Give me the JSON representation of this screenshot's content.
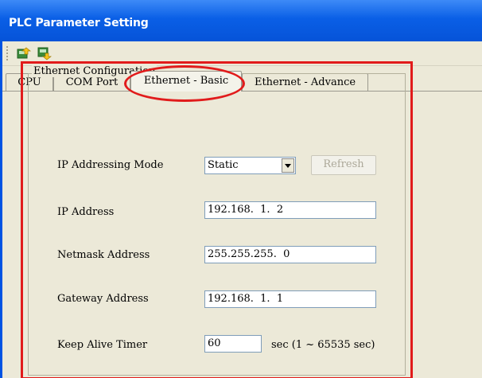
{
  "window": {
    "title": "PLC Parameter Setting"
  },
  "toolbar": {
    "buttons": [
      {
        "icon": "upload-icon"
      },
      {
        "icon": "download-icon"
      }
    ]
  },
  "tabs": [
    {
      "label": "CPU"
    },
    {
      "label": "COM Port"
    },
    {
      "label": "Ethernet - Basic",
      "active": true
    },
    {
      "label": "Ethernet - Advance"
    }
  ],
  "ethernet_config": {
    "title": "Ethernet Configuration",
    "ip_mode": {
      "label": "IP Addressing Mode",
      "value": "Static",
      "refresh_label": "Refresh"
    },
    "ip_address": {
      "label": "IP Address",
      "value": "192.168.  1.  2"
    },
    "netmask": {
      "label": "Netmask Address",
      "value": "255.255.255.  0"
    },
    "gateway": {
      "label": "Gateway Address",
      "value": "192.168.  1.  1"
    },
    "keep_alive": {
      "label": "Keep Alive Timer",
      "value": "60",
      "unit": "sec (1 ~ 65535 sec)"
    }
  },
  "colors": {
    "title_bar": "#0a5fe6",
    "highlight": "#e11b1b",
    "panel": "#ece9d8"
  }
}
